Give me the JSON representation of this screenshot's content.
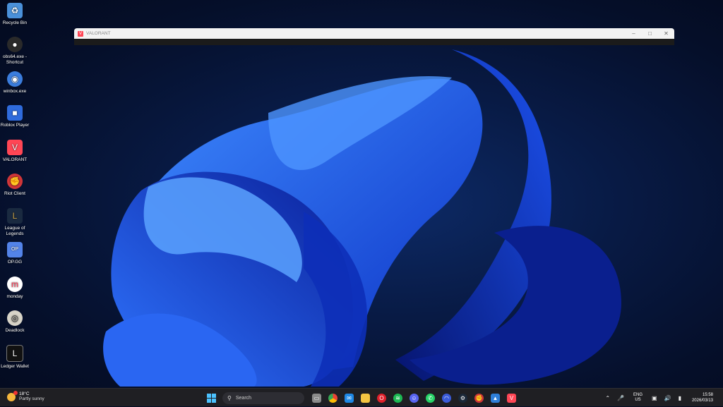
{
  "desktop": {
    "icons": [
      {
        "label": "Recycle Bin",
        "icon": "recycle-bin-icon",
        "color": "#4a90d9"
      },
      {
        "label": "obs64.exe - Shortcut",
        "icon": "obs-icon",
        "color": "#2a2a2a"
      },
      {
        "label": "winbox.exe",
        "icon": "winbox-icon",
        "color": "#3b7ddd"
      },
      {
        "label": "Roblox Player",
        "icon": "roblox-icon",
        "color": "#2f6bdc"
      },
      {
        "label": "VALORANT",
        "icon": "valorant-icon",
        "color": "#ff4655"
      },
      {
        "label": "Riot Client",
        "icon": "riot-client-icon",
        "color": "#d13639"
      },
      {
        "label": "League of Legends",
        "icon": "league-of-legends-icon",
        "color": "#c8a24a"
      },
      {
        "label": "OP.GG",
        "icon": "opgg-icon",
        "color": "#5383e8"
      },
      {
        "label": "monday",
        "icon": "monday-icon",
        "color": "#ffffff"
      },
      {
        "label": "Deadlock",
        "icon": "deadlock-icon",
        "color": "#d8d4c8"
      },
      {
        "label": "Ledger Wallet",
        "icon": "ledger-wallet-icon",
        "color": "#111111"
      }
    ]
  },
  "window": {
    "title": "VALORANT",
    "accent": "#ff4655"
  },
  "taskbar": {
    "weather": {
      "temp": "18°C",
      "condition": "Partly sunny"
    },
    "search": {
      "placeholder": "Search"
    },
    "apps": [
      {
        "name": "file-explorer-view",
        "icon": "task-view-icon",
        "color": "#8a8a8a"
      },
      {
        "name": "chrome",
        "icon": "chrome-icon",
        "color": "#4285f4"
      },
      {
        "name": "mail",
        "icon": "mail-icon",
        "color": "#1e88e5"
      },
      {
        "name": "file-explorer",
        "icon": "folder-icon",
        "color": "#f4c542"
      },
      {
        "name": "opera",
        "icon": "opera-icon",
        "color": "#e0202a"
      },
      {
        "name": "spotify",
        "icon": "spotify-icon",
        "color": "#1db954"
      },
      {
        "name": "discord",
        "icon": "discord-icon",
        "color": "#5865f2"
      },
      {
        "name": "whatsapp",
        "icon": "whatsapp-icon",
        "color": "#25d366"
      },
      {
        "name": "arc",
        "icon": "arc-icon",
        "color": "#3a5bd9"
      },
      {
        "name": "steam",
        "icon": "steam-icon",
        "color": "#1b2838"
      },
      {
        "name": "riot-client",
        "icon": "riot-client-icon",
        "color": "#d13639"
      },
      {
        "name": "photos",
        "icon": "photos-icon",
        "color": "#2f7fd8"
      },
      {
        "name": "valorant",
        "icon": "valorant-icon",
        "color": "#ff4655"
      }
    ],
    "tray": {
      "lang_top": "ENG",
      "lang_bottom": "US",
      "time": "15:58",
      "date": "2026/03/13"
    }
  }
}
